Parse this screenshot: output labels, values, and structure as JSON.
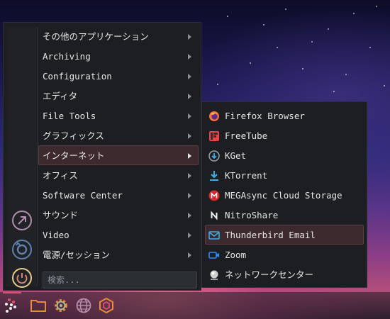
{
  "menu": {
    "categories": [
      {
        "label": "その他のアプリケーション"
      },
      {
        "label": "Archiving"
      },
      {
        "label": "Configuration"
      },
      {
        "label": "エディタ"
      },
      {
        "label": "File Tools"
      },
      {
        "label": "グラフィックス"
      },
      {
        "label": "インターネット",
        "active": true
      },
      {
        "label": "オフィス"
      },
      {
        "label": "Software Center"
      },
      {
        "label": "サウンド"
      },
      {
        "label": "Video"
      },
      {
        "label": "電源/セッション"
      }
    ],
    "search_placeholder": "検索...",
    "favorites": [
      {
        "icon": "open-link-icon",
        "color": "#b48ead"
      },
      {
        "icon": "refresh-icon",
        "color": "#5e81ac"
      },
      {
        "icon": "power-icon",
        "color": "#ebcb8b"
      }
    ]
  },
  "submenu": {
    "items": [
      {
        "label": "Firefox Browser",
        "icon": "firefox-icon"
      },
      {
        "label": "FreeTube",
        "icon": "freetube-icon"
      },
      {
        "label": "KGet",
        "icon": "kget-icon"
      },
      {
        "label": "KTorrent",
        "icon": "ktorrent-icon"
      },
      {
        "label": "MEGAsync Cloud Storage",
        "icon": "mega-icon"
      },
      {
        "label": "NitroShare",
        "icon": "nitroshare-icon"
      },
      {
        "label": "Thunderbird Email",
        "icon": "thunderbird-icon",
        "active": true
      },
      {
        "label": "Zoom",
        "icon": "zoom-icon"
      },
      {
        "label": "ネットワークセンター",
        "icon": "network-icon"
      }
    ]
  },
  "taskbar": {
    "items": [
      {
        "icon": "app-menu-icon",
        "active": true
      },
      {
        "icon": "folder-icon"
      },
      {
        "icon": "settings-gear-icon"
      },
      {
        "icon": "globe-icon"
      },
      {
        "icon": "package-icon"
      }
    ]
  },
  "colors": {
    "menu_bg": "#1c1e22",
    "highlight": "#3c2a2e",
    "accent": "#e0506a"
  }
}
